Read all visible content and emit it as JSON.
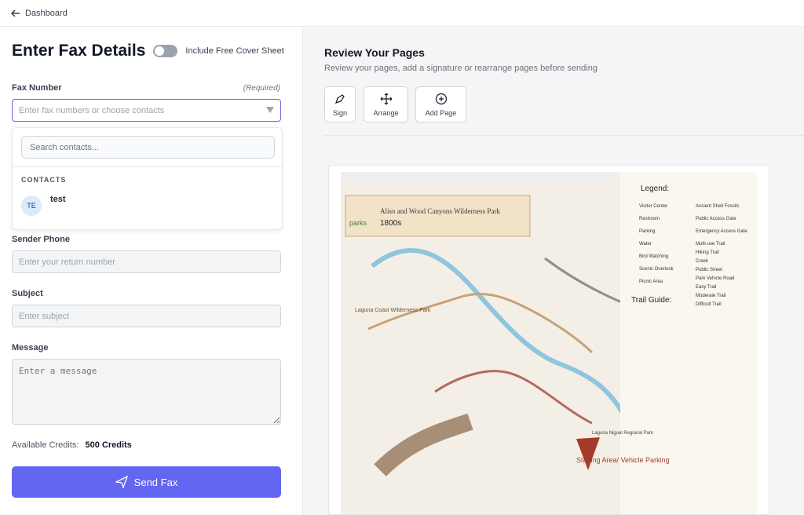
{
  "topbar": {
    "back_label": "Dashboard"
  },
  "left": {
    "title": "Enter Fax Details",
    "cover_sheet_label": "Include Free Cover Sheet",
    "fax_label": "Fax Number",
    "fax_required": "(Required)",
    "fax_placeholder": "Enter fax numbers or choose contacts",
    "search_contacts_placeholder": "Search contacts...",
    "contacts_heading": "CONTACTS",
    "contact": {
      "initials": "TE",
      "name": "test"
    },
    "sender_phone_label": "Sender Phone",
    "sender_phone_placeholder": "Enter your return number",
    "subject_label": "Subject",
    "subject_placeholder": "Enter subject",
    "message_label": "Message",
    "message_placeholder": "Enter a message",
    "credits_label": "Available Credits:",
    "credits_value": "500 Credits",
    "send_label": "Send Fax"
  },
  "right": {
    "title": "Review Your Pages",
    "subtitle": "Review your pages, add a signature or rearrange pages before sending",
    "tools": [
      {
        "label": "Sign",
        "icon": "pen-icon"
      },
      {
        "label": "Arrange",
        "icon": "move-icon"
      },
      {
        "label": "Add Page",
        "icon": "plus-circle-icon"
      }
    ],
    "preview": {
      "title": "Aliso and Wood Canyons Wilderness Park",
      "logo_text": "parks",
      "date_text": "1800s",
      "legend_title": "Legend:",
      "legend_items": [
        "Visitor Center",
        "Restroom",
        "Parking",
        "Water",
        "Bird Watching",
        "Scenic Overlook",
        "Picnic Area",
        "Ancient Shell Fossils",
        "Public Access Gate",
        "Emergency Access Gate",
        "Multi-use Trail",
        "Hiking Trail",
        "Creek",
        "Public Street",
        "Park Vehicle Road",
        "Easy Trail",
        "Moderate Trail",
        "Difficult Trail"
      ],
      "trail_guide_title": "Trail Guide:",
      "region_label": "Laguna Coast Wilderness Park",
      "parking_label": "Staging Area/ Vehicle Parking",
      "regional_park_label": "Laguna Niguel Regional Park"
    }
  }
}
